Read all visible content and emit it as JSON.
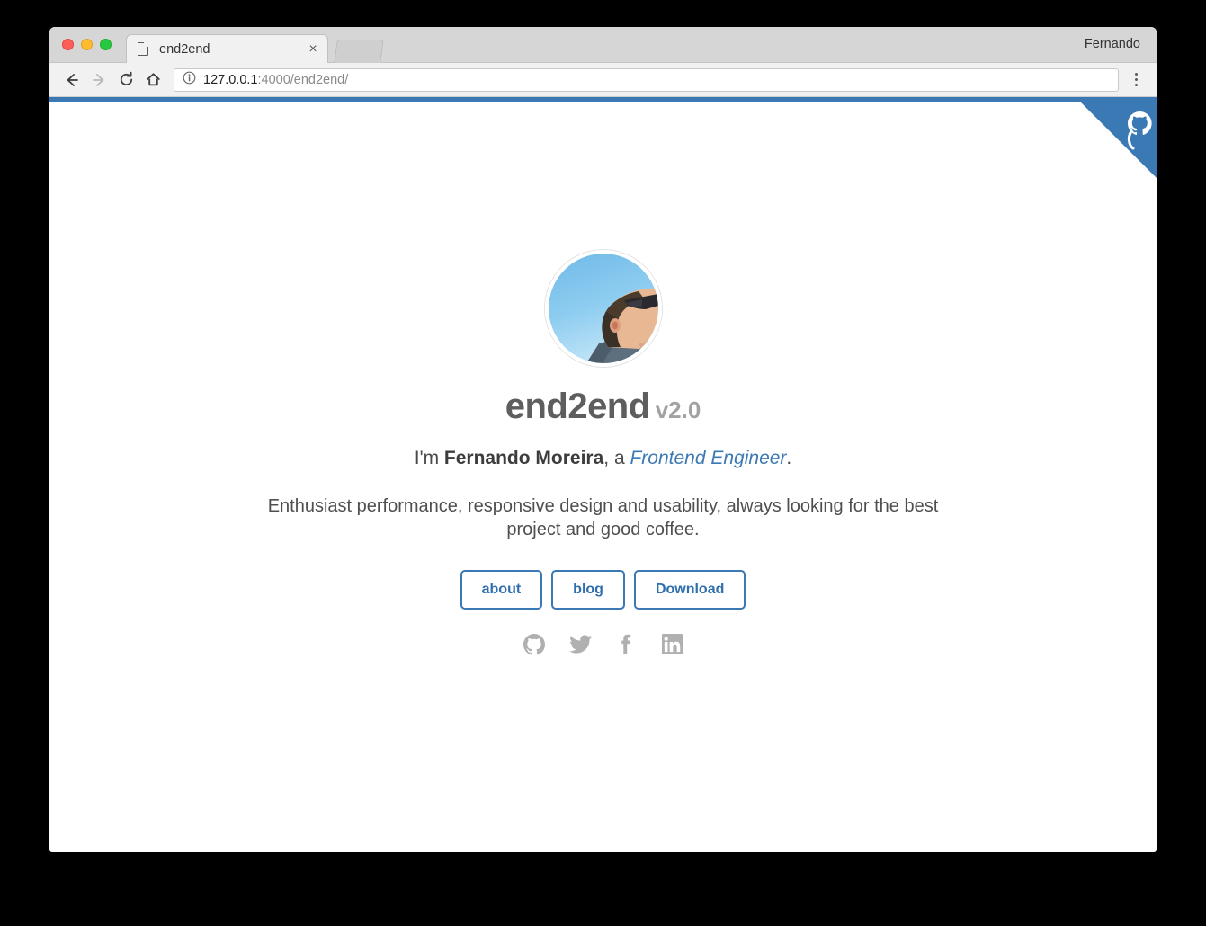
{
  "browser": {
    "window_controls": [
      "close",
      "minimize",
      "maximize"
    ],
    "tab": {
      "title": "end2end",
      "page_icon": "page-icon",
      "close_label": "×"
    },
    "new_tab_stub": "",
    "profile_name": "Fernando",
    "toolbar": {
      "back_label": "back-arrow",
      "forward_label": "forward-arrow",
      "reload_label": "reload-arrow",
      "home_label": "home",
      "menu_label": "more-options",
      "url_host": "127.0.0.1",
      "url_rest": ":4000/end2end/",
      "url_full": "127.0.0.1:4000/end2end/",
      "security_icon": "info-circle-icon"
    }
  },
  "page": {
    "accent_color": "#3b79b4",
    "title_color": "#5e5e5e",
    "version_color": "#a2a2a2",
    "social_icon_color": "#b0b0b0",
    "ribbon": {
      "label": "github-corner-ribbon",
      "color": "#3b79b4"
    },
    "avatar_alt": "profile-photo",
    "title": "end2end",
    "version": "v2.0",
    "tagline": {
      "prefix": "I'm ",
      "name": "Fernando Moreira",
      "middle": ", a ",
      "role": "Frontend Engineer",
      "suffix": "."
    },
    "blurb": "Enthusiast performance, responsive design and usability, always looking for the best project and good coffee.",
    "buttons": [
      {
        "label": "about"
      },
      {
        "label": "blog"
      },
      {
        "label": "Download"
      }
    ],
    "socials": [
      {
        "name": "github",
        "label": "GitHub"
      },
      {
        "name": "twitter",
        "label": "Twitter"
      },
      {
        "name": "facebook",
        "label": "Facebook"
      },
      {
        "name": "linkedin",
        "label": "LinkedIn"
      }
    ]
  }
}
